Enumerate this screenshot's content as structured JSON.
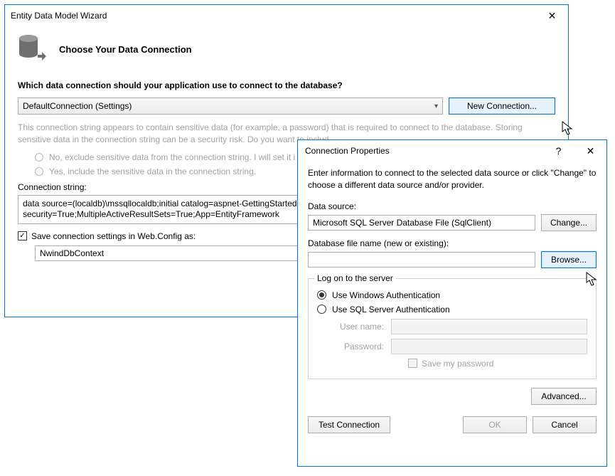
{
  "wizard": {
    "title": "Entity Data Model Wizard",
    "heading": "Choose Your Data Connection",
    "question": "Which data connection should your application use to connect to the database?",
    "connection_selected": "DefaultConnection (Settings)",
    "new_connection_btn": "New Connection...",
    "sensitive_warning": "This connection string appears to contain sensitive data (for example, a password) that is required to connect to the database. Storing sensitive data in the connection string can be a security risk. Do you want to includ",
    "radio_exclude": "No, exclude sensitive data from the connection string. I will set it i",
    "radio_include": "Yes, include the sensitive data in the connection string.",
    "conn_string_label": "Connection string:",
    "conn_string_value": "data source=(localdb)\\mssqllocaldb;initial catalog=aspnet-GettingStarted\nsecurity=True;MultipleActiveResultSets=True;App=EntityFramework",
    "save_settings_label": "Save connection settings in Web.Config as:",
    "save_settings_value": "NwindDbContext"
  },
  "conn_props": {
    "title": "Connection Properties",
    "intro": "Enter information to connect to the selected data source or click \"Change\" to choose a different data source and/or provider.",
    "data_source_label": "Data source:",
    "data_source_value": "Microsoft SQL Server Database File (SqlClient)",
    "change_btn": "Change...",
    "db_file_label": "Database file name (new or existing):",
    "db_file_value": "",
    "browse_btn": "Browse...",
    "logon_legend": "Log on to the server",
    "use_windows": "Use Windows Authentication",
    "use_sql": "Use SQL Server Authentication",
    "username_label": "User name:",
    "password_label": "Password:",
    "save_password_label": "Save my password",
    "advanced_btn": "Advanced...",
    "test_btn": "Test Connection",
    "ok_btn": "OK",
    "cancel_btn": "Cancel"
  }
}
